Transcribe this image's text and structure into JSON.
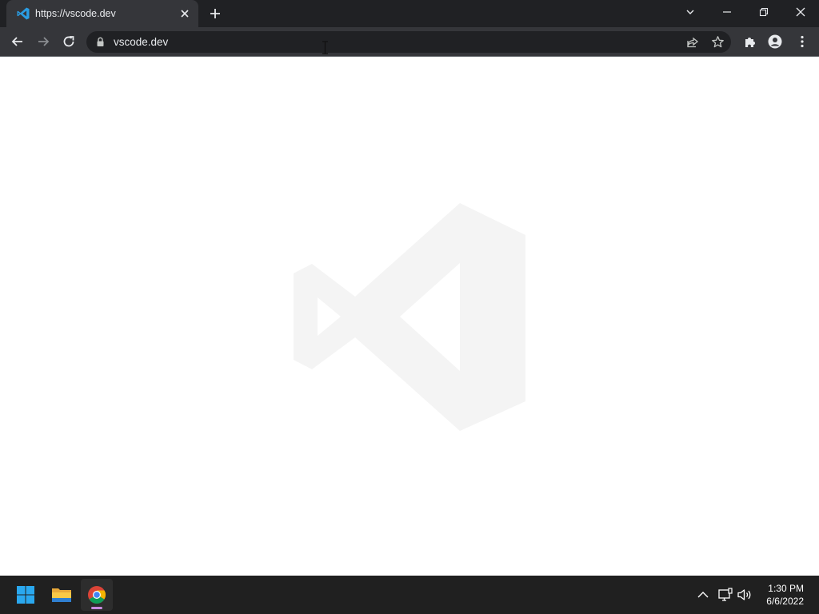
{
  "browser": {
    "tab": {
      "title": "https://vscode.dev",
      "favicon": "vscode-icon"
    },
    "address_bar": {
      "url": "vscode.dev",
      "security_icon": "lock-icon"
    },
    "toolbar_icons": [
      "back-arrow-icon",
      "forward-arrow-icon",
      "reload-icon",
      "share-icon",
      "star-icon",
      "extensions-icon",
      "profile-icon",
      "menu-icon"
    ],
    "window_controls": [
      "tab-search-icon",
      "minimize-icon",
      "restore-icon",
      "close-icon"
    ]
  },
  "page": {
    "content": "vscode-logo-watermark"
  },
  "taskbar": {
    "apps": [
      "windows-start-icon",
      "file-explorer-icon",
      "chrome-icon"
    ],
    "clock": {
      "time": "1:30 PM",
      "date": "6/6/2022"
    }
  },
  "colors": {
    "titlebar": "#202124",
    "toolbar": "#35363a",
    "omnibox": "#202124",
    "taskbar": "#202020",
    "vscode_blue": "#2a9de3"
  }
}
